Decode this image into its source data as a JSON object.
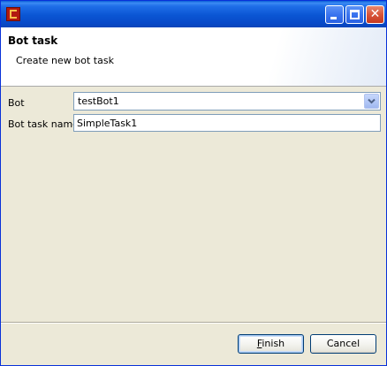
{
  "window": {
    "title": "",
    "icon": "application-icon"
  },
  "titlebar_buttons": {
    "minimize": "minimize-icon",
    "maximize": "maximize-icon",
    "close_glyph": "✕"
  },
  "header": {
    "title": "Bot task",
    "subtitle": "Create new bot task"
  },
  "form": {
    "bot_label": "Bot",
    "bot_value": "testBot1",
    "task_name_label": "Bot task name",
    "task_name_value": "SimpleTask1"
  },
  "buttons": {
    "finish_mnemonic": "F",
    "finish_rest": "inish",
    "cancel": "Cancel"
  },
  "colors": {
    "titlebar": "#0a55d3",
    "dialog_bg": "#ece9d8",
    "field_border": "#7f9db9",
    "close_button": "#d8553a"
  }
}
